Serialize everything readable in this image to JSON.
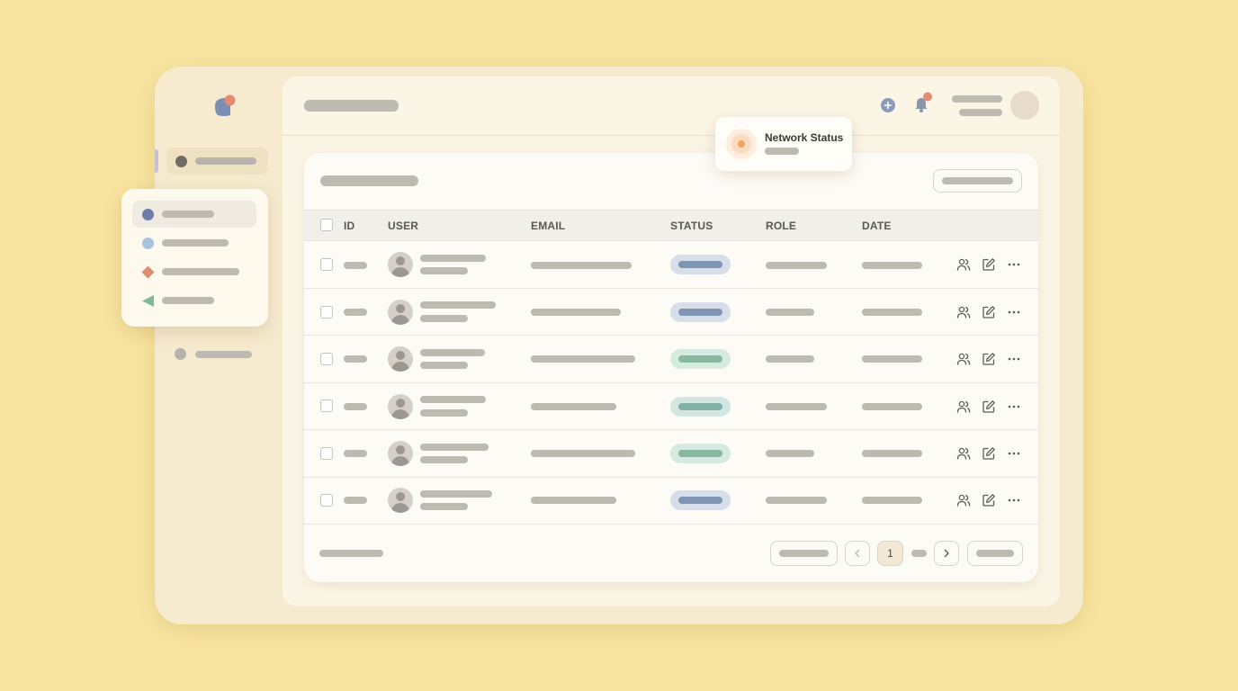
{
  "colors": {
    "background": "#f8e4a0",
    "window": "#f6ebcf",
    "accent_blue": "#7786b0",
    "accent_coral": "#e28a74",
    "status_blue": "#8095b3",
    "status_green": "#87b9a0"
  },
  "header": {
    "icons": [
      "plus-icon",
      "bell-icon"
    ]
  },
  "tooltip": {
    "title": "Network Status"
  },
  "table": {
    "columns": [
      "ID",
      "USER",
      "EMAIL",
      "STATUS",
      "ROLE",
      "DATE"
    ],
    "rows": [
      {
        "status_color": "blue"
      },
      {
        "status_color": "blue"
      },
      {
        "status_color": "green"
      },
      {
        "status_color": "teal"
      },
      {
        "status_color": "green"
      },
      {
        "status_color": "blue"
      }
    ],
    "row_actions": [
      "users-icon",
      "edit-icon",
      "more-icon"
    ]
  },
  "pagination": {
    "current_page": "1"
  }
}
